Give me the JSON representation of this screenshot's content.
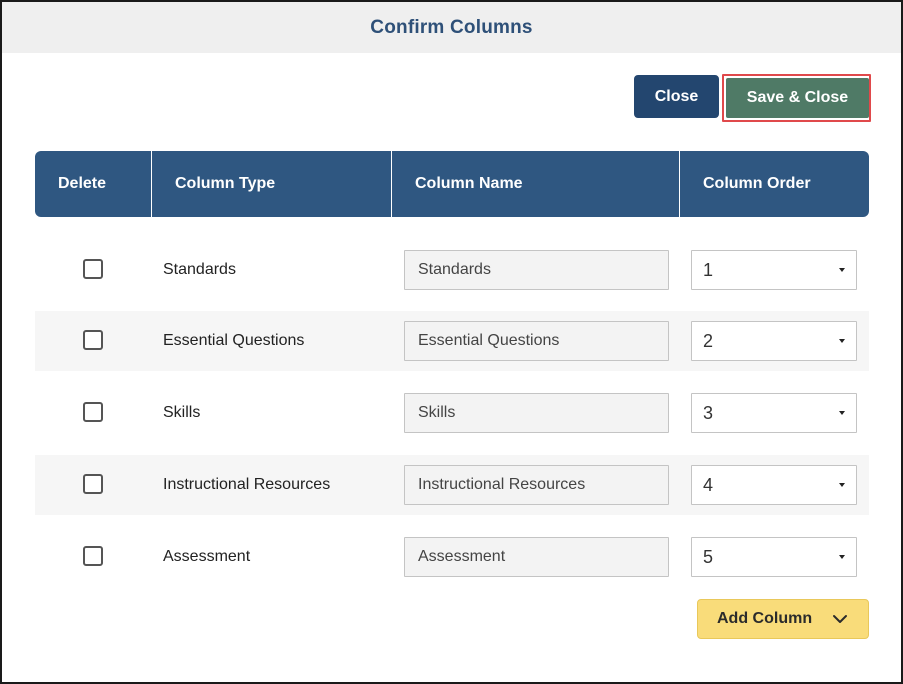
{
  "modal": {
    "title": "Confirm Columns"
  },
  "actions": {
    "close_label": "Close",
    "save_close_label": "Save & Close",
    "add_column_label": "Add Column"
  },
  "table": {
    "headers": [
      "Delete",
      "Column Type",
      "Column Name",
      "Column Order"
    ],
    "rows": [
      {
        "checked": false,
        "type": "Standards",
        "name": "Standards",
        "order": "1"
      },
      {
        "checked": false,
        "type": "Essential Questions",
        "name": "Essential Questions",
        "order": "2"
      },
      {
        "checked": false,
        "type": "Skills",
        "name": "Skills",
        "order": "3"
      },
      {
        "checked": false,
        "type": "Instructional Resources",
        "name": "Instructional Resources",
        "order": "4"
      },
      {
        "checked": false,
        "type": "Assessment",
        "name": "Assessment",
        "order": "5"
      }
    ]
  },
  "colors": {
    "header_bg": "#2f5781",
    "title_text": "#2e5078",
    "close_button": "#23466f",
    "save_button": "#4f7a66",
    "save_highlight": "#e0494b",
    "add_button": "#f9dc7a"
  },
  "icons": {
    "select_caret": "caret-down-icon",
    "add_column_chevron": "chevron-down-icon"
  }
}
